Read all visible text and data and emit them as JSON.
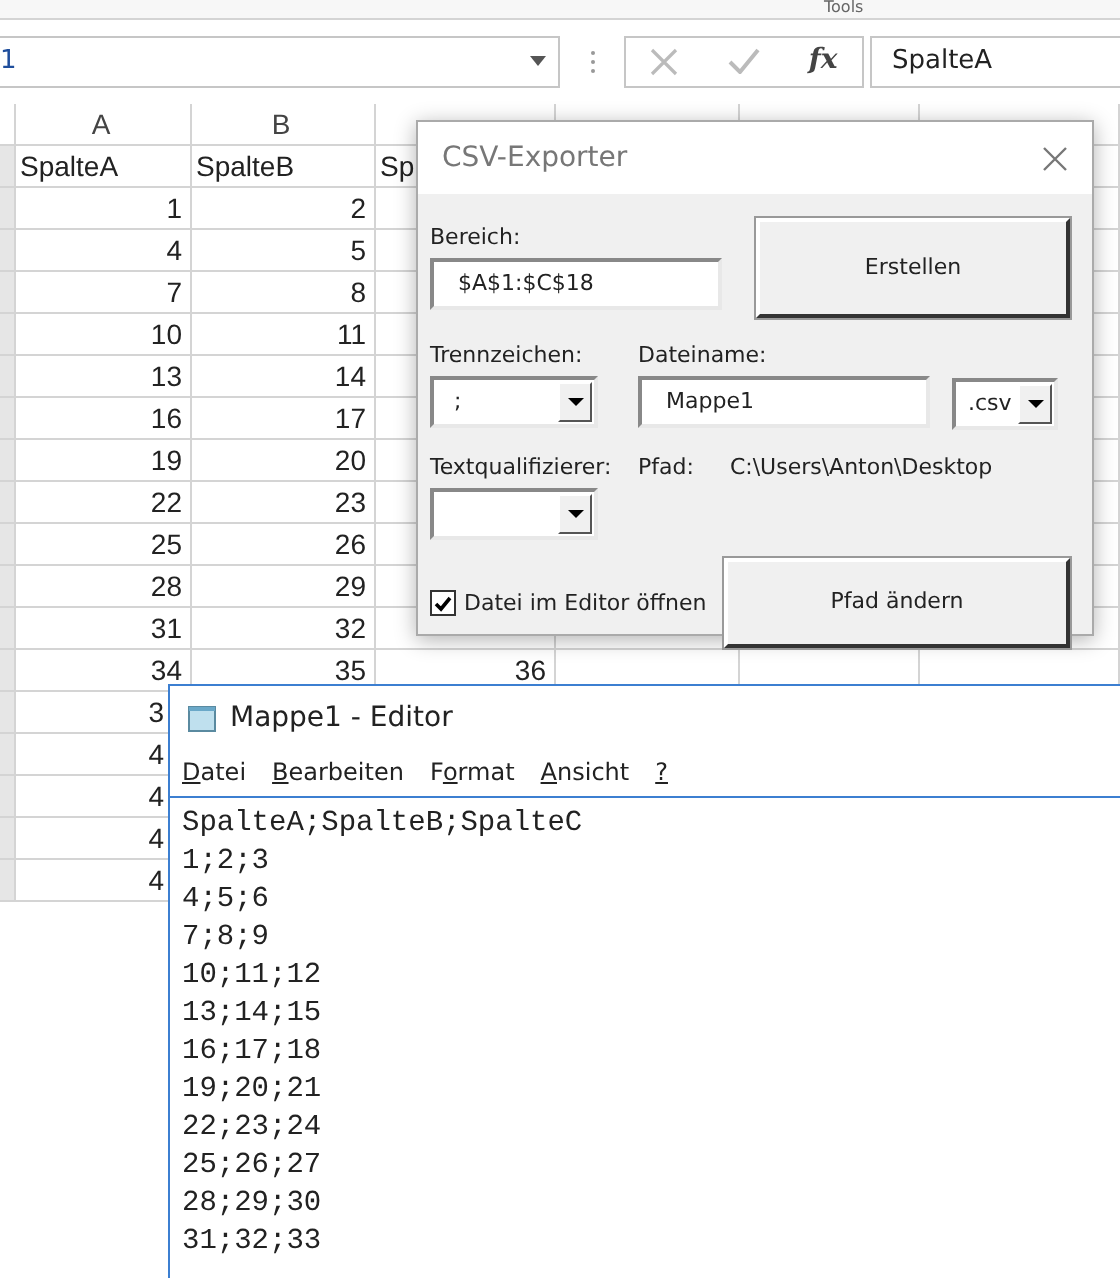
{
  "ribbon": {
    "group_label": "Tools"
  },
  "formula_bar": {
    "name_box": "1",
    "function_label": "fx",
    "formula": "SpalteA"
  },
  "sheet": {
    "columns": [
      "A",
      "B"
    ],
    "rows": [
      {
        "kind": "header",
        "cells": [
          "SpalteA",
          "SpalteB",
          "Sp"
        ]
      },
      {
        "kind": "number",
        "cells": [
          "1",
          "2"
        ]
      },
      {
        "kind": "number",
        "cells": [
          "4",
          "5"
        ]
      },
      {
        "kind": "number",
        "cells": [
          "7",
          "8"
        ]
      },
      {
        "kind": "number",
        "cells": [
          "10",
          "11"
        ]
      },
      {
        "kind": "number",
        "cells": [
          "13",
          "14"
        ]
      },
      {
        "kind": "number",
        "cells": [
          "16",
          "17"
        ]
      },
      {
        "kind": "number",
        "cells": [
          "19",
          "20"
        ]
      },
      {
        "kind": "number",
        "cells": [
          "22",
          "23"
        ]
      },
      {
        "kind": "number",
        "cells": [
          "25",
          "26"
        ]
      },
      {
        "kind": "number",
        "cells": [
          "28",
          "29"
        ]
      },
      {
        "kind": "number",
        "cells": [
          "31",
          "32"
        ]
      },
      {
        "kind": "number",
        "cells": [
          "34",
          "35",
          "36"
        ]
      },
      {
        "kind": "cut",
        "cells": [
          "3"
        ]
      },
      {
        "kind": "cut",
        "cells": [
          "4"
        ]
      },
      {
        "kind": "cut",
        "cells": [
          "4"
        ]
      },
      {
        "kind": "cut",
        "cells": [
          "4"
        ]
      },
      {
        "kind": "cut",
        "cells": [
          "4"
        ]
      }
    ]
  },
  "dialog": {
    "title": "CSV-Exporter",
    "range_label": "Bereich:",
    "range_value": "$A$1:$C$18",
    "create_button": "Erstellen",
    "separator_label": "Trennzeichen:",
    "separator_value": ";",
    "filename_label": "Dateiname:",
    "filename_value": "Mappe1",
    "extension_value": ".csv",
    "qualifier_label": "Textqualifizierer:",
    "path_label": "Pfad:",
    "path_value": "C:\\Users\\Anton\\Desktop",
    "open_in_editor": {
      "label": "Datei im Editor öffnen",
      "checked": true
    },
    "change_path_button": "Pfad ändern"
  },
  "editor": {
    "title": "Mappe1 - Editor",
    "menu": [
      {
        "key": "D",
        "after": "atei"
      },
      {
        "key": "B",
        "after": "earbeiten"
      },
      {
        "before": "F",
        "key": "o",
        "after": "rmat"
      },
      {
        "key": "A",
        "after": "nsicht"
      },
      {
        "key": "?"
      }
    ],
    "lines": [
      "SpalteA;SpalteB;SpalteC",
      "1;2;3",
      "4;5;6",
      "7;8;9",
      "10;11;12",
      "13;14;15",
      "16;17;18",
      "19;20;21",
      "22;23;24",
      "25;26;27",
      "28;29;30",
      "31;32;33"
    ]
  }
}
